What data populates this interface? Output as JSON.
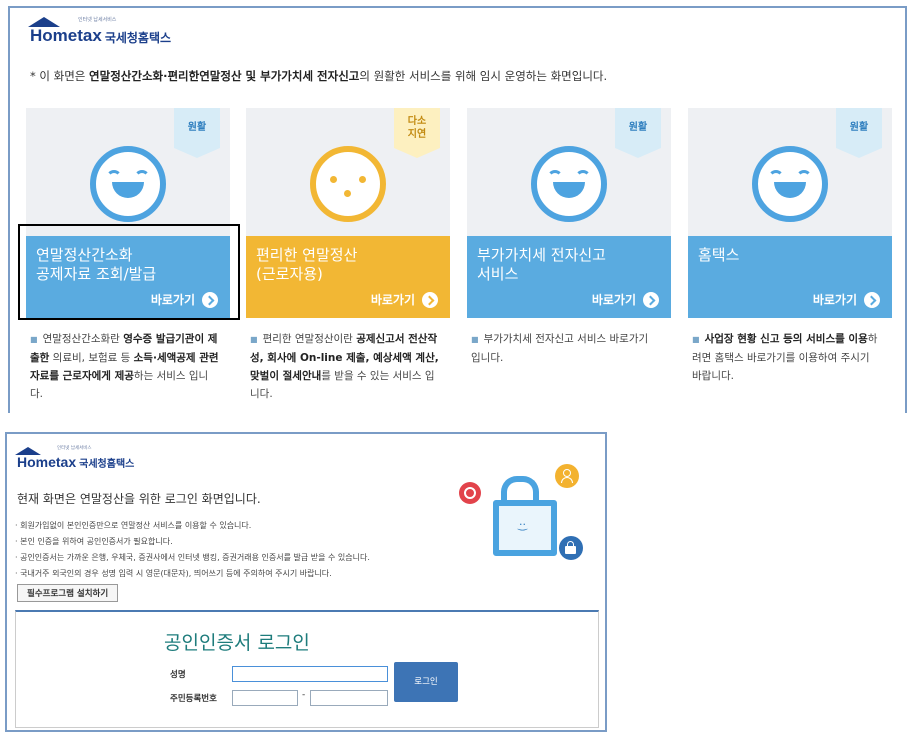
{
  "top": {
    "logo": {
      "brand": "Hometax",
      "korean": "국세청홈택스",
      "tagline": "인터넷 납세서비스"
    },
    "notice": {
      "prefix": "* 이 화면은 ",
      "bold1": "연말정산간소화·편리한연말정산",
      "mid1": " 및 ",
      "bold2": "부가가치세 전자신고",
      "suffix": "의 원활한 서비스를 위해 임시 운영하는 화면입니다."
    },
    "cards": [
      {
        "badge": "원활",
        "title1": "연말정산간소화",
        "title2": "공제자료 조회/발급",
        "go": "바로가기",
        "desc": [
          "연말정산간소화란 ",
          "영수증 발급기관이 제출한",
          " 의료비, 보험료 등 ",
          "소득·세액공제 관련 자료를 근로자에게 제공",
          "하는 서비스 입니다."
        ]
      },
      {
        "badge1": "다소",
        "badge2": "지연",
        "title1": "편리한 연말정산",
        "title2": "(근로자용)",
        "go": "바로가기",
        "desc": [
          "편리한 연말정산이란 ",
          "공제신고서 전산작성, 회사에 On-line 제출, 예상세액 계산, 맞벌이 절세안내",
          "를 받을 수 있는 서비스 입니다."
        ]
      },
      {
        "badge": "원활",
        "title1": "부가가치세 전자신고",
        "title2": "서비스",
        "go": "바로가기",
        "desc": [
          "부가가치세 전자신고 서비스 바로가기 입니다."
        ]
      },
      {
        "badge": "원활",
        "title1": "홈택스",
        "title2": "",
        "go": "바로가기",
        "desc": [
          "사업장 현황 신고 등의 서비스를 이용",
          "하려면 홈택스 바로가기를 이용하여 주시기 바랍니다."
        ]
      }
    ]
  },
  "bottom": {
    "logo": {
      "brand": "Hometax",
      "korean": "국세청홈택스",
      "tagline": "인터넷 납세서비스"
    },
    "intro": "현재 화면은 연말정산을 위한 로그인 화면입니다.",
    "bullets": [
      "· 회원가입없이 본인인증만으로 연말정산 서비스를 이용할 수 있습니다.",
      "· 본인 인증을 위하여 공인인증서가 필요합니다.",
      "· 공인인증서는 가까운 은행, 우체국, 증권사에서 인터넷 뱅킹, 증권거래용 인증서를 발급 받을 수 있습니다.",
      "· 국내거주 외국인의 경우 성명 입력 시 영문(대문자), 띄어쓰기 등에 주의하여 주시기 바랍니다."
    ],
    "install_button": "필수프로그램 설치하기",
    "login": {
      "title": "공인인증서 로그인",
      "name_label": "성명",
      "rrn_label": "주민등록번호",
      "rrn_separator": "-",
      "button": "로그인"
    }
  }
}
